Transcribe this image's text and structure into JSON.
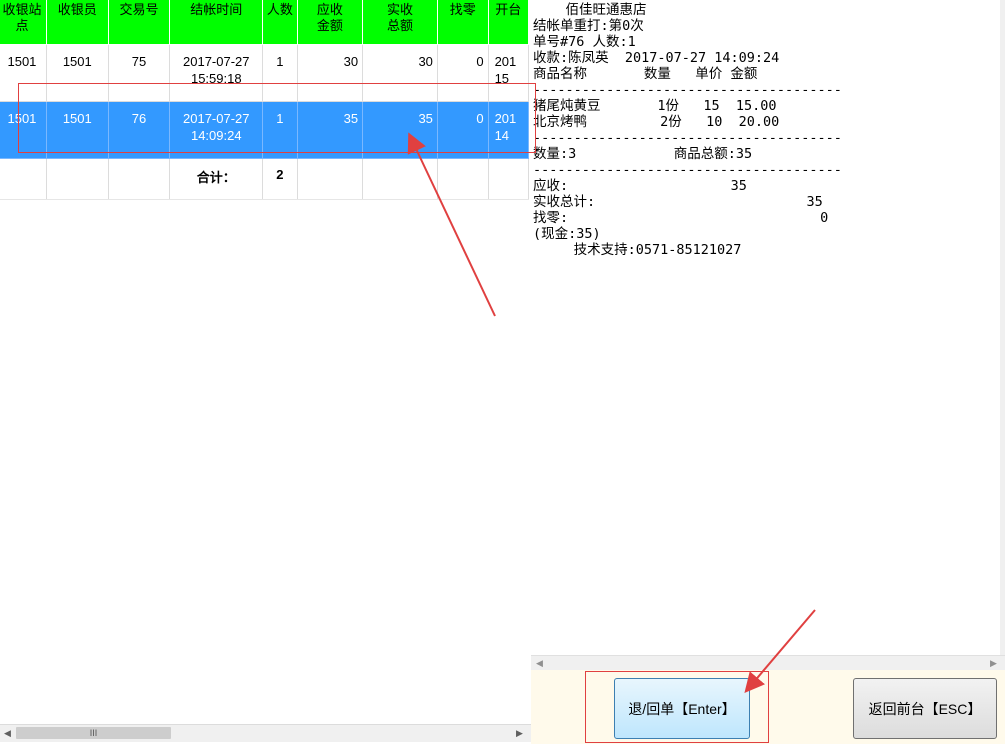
{
  "grid": {
    "headers": [
      "收银站\n点",
      "收银员",
      "交易号",
      "结帐时间",
      "人数",
      "应收\n金额",
      "实收\n总额",
      "找零",
      "开台"
    ],
    "rows": [
      {
        "station": "1501",
        "cashier": "1501",
        "trade_no": "75",
        "time": "2017-07-27\n15:59:18",
        "people": "1",
        "due": "30",
        "received": "30",
        "change": "0",
        "open": "201\n15",
        "selected": false
      },
      {
        "station": "1501",
        "cashier": "1501",
        "trade_no": "76",
        "time": "2017-07-27\n14:09:24",
        "people": "1",
        "due": "35",
        "received": "35",
        "change": "0",
        "open": "201\n14",
        "selected": true
      }
    ],
    "total_label": "合计：",
    "total_people": "2",
    "scroll_grip": "III"
  },
  "receipt": {
    "lines": [
      "    佰佳旺通惠店",
      "结帐单重打:第0次",
      "单号#76 人数:1",
      "收款:陈凤英  2017-07-27 14:09:24",
      "商品名称       数量   单价 金额",
      "--------------------------------------",
      "猪尾炖黄豆       1份   15  15.00",
      "北京烤鸭         2份   10  20.00",
      "--------------------------------------",
      "数量:3            商品总额:35",
      "--------------------------------------",
      "应收:                    35",
      "实收总计:                          35",
      "找零:                               0",
      "(现金:35)",
      "     技术支持:0571-85121027"
    ]
  },
  "buttons": {
    "return_label": "退/回单【Enter】",
    "back_label": "返回前台【ESC】"
  },
  "colors": {
    "header_bg": "#00ff00",
    "selected_row_bg": "#3399ff",
    "annotation_red": "#e04040",
    "button_bar_bg": "#fffaeb"
  }
}
